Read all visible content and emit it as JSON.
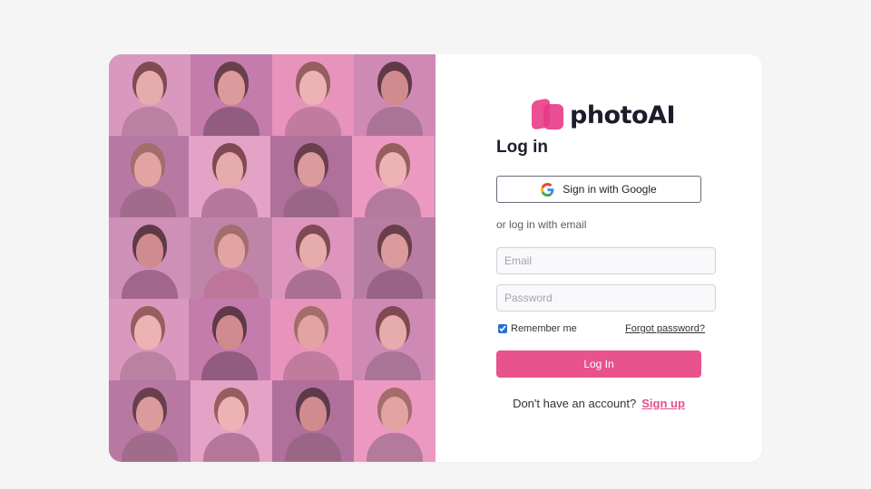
{
  "brand": {
    "name": "photoAI",
    "accent": "#e8528d"
  },
  "login": {
    "title": "Log in",
    "google_label": "Sign in with Google",
    "or_text": "or log in with email",
    "email_placeholder": "Email",
    "password_placeholder": "Password",
    "remember_label": "Remember me",
    "remember_checked": true,
    "forgot_label": "Forgot password?",
    "submit_label": "Log In",
    "signup_prompt": "Don't have an account?",
    "signup_link": "Sign up"
  },
  "collage": {
    "description_icon": "portrait-grid",
    "palette": [
      "#d8a6c4",
      "#b77fa8",
      "#e99fbf",
      "#c891b6",
      "#a77a9f",
      "#e5b3cd",
      "#9b6e93",
      "#f0a7c7",
      "#c79ab9",
      "#b58aa6",
      "#dba1c2",
      "#a8809c"
    ]
  }
}
